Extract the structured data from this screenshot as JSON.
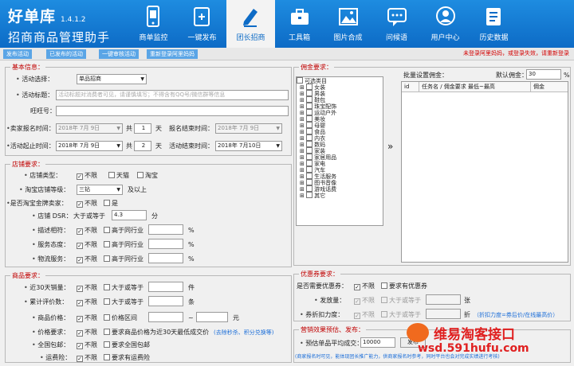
{
  "app": {
    "name": "好单库",
    "version": "1.4.1.2",
    "subtitle": "招商商品管理助手"
  },
  "nav": [
    {
      "label": "商单监控",
      "icon": "phone-monitor-icon"
    },
    {
      "label": "一键发布",
      "icon": "publish-icon"
    },
    {
      "label": "团长招商",
      "icon": "pen-icon"
    },
    {
      "label": "工具箱",
      "icon": "toolbox-icon"
    },
    {
      "label": "图片合成",
      "icon": "image-icon"
    },
    {
      "label": "问候语",
      "icon": "chat-icon"
    },
    {
      "label": "用户中心",
      "icon": "user-icon"
    },
    {
      "label": "历史数据",
      "icon": "history-icon"
    }
  ],
  "actions": {
    "publish": "发布活动",
    "published": "已发布的活动",
    "sync": "一键审核活动",
    "relogin": "重新登录阿里妈妈"
  },
  "warning": "未登录阿里妈妈，或登录失效，请重新登录",
  "basic": {
    "title": "基本信息：",
    "activity_select_label": "活动选择：",
    "activity_select_value": "单品招商",
    "activity_title_label": "活动标题：",
    "activity_title_placeholder": "活动标题对消费者可见，请谨慎填写；不得含有QQ号/微信群等信息",
    "wangwang_label": "旺旺号：",
    "sign_start_label": "卖家报名时间：",
    "sign_start_date": "2018年 7月 9日",
    "days_prefix": "共",
    "sign_days": "1",
    "days_suffix": "天",
    "sign_end_label": "报名结束时间：",
    "sign_end_date": "2018年 7月 9日",
    "act_start_label": "活动起止时间：",
    "act_start_date": "2018年 7月 9日",
    "act_days": "2",
    "act_end_label": "活动结束时间：",
    "act_end_date": "2018年 7月10日"
  },
  "shop": {
    "title": "店铺要求：",
    "type_label": "店铺类型：",
    "unlimited": "不限",
    "tmall": "天猫",
    "taobao": "淘宝",
    "level_label": "淘宝店铺等级：",
    "level_value": "三钻",
    "level_suffix": "及以上",
    "gold_label": "是否淘宝金牌卖家：",
    "yes": "是",
    "dsr_label": "店铺 DSR：",
    "dsr_prefix": "大于或等于",
    "dsr_value": "4.3",
    "dsr_unit": "分",
    "desc_label": "描述相符：",
    "above_industry": "高于同行业",
    "service_label": "服务态度：",
    "logistics_label": "物流服务：",
    "pct": "%"
  },
  "goods": {
    "title": "商品要求：",
    "sales_label": "近30天销量：",
    "gte": "大于或等于",
    "sales_unit": "件",
    "reviews_label": "累计评价数：",
    "reviews_unit": "条",
    "price_label": "商品价格：",
    "price_range": "价格区间",
    "tilde": "~",
    "yuan": "元",
    "price_req_label": "价格要求：",
    "price_req_opt": "要求商品价格为近30天最低成交价",
    "price_req_hint": "(去除秒杀、积分兑换等)",
    "freeship_label": "全国包邮：",
    "freeship_opt": "要求全国包邮",
    "insurance_label": "运费险：",
    "insurance_opt": "要求有运费险"
  },
  "commission": {
    "title": "佣金要求：",
    "root": "可选类目",
    "categories": [
      "女装",
      "男装",
      "鞋包",
      "珠宝配饰",
      "运动户外",
      "美妆",
      "母婴",
      "食品",
      "内衣",
      "数码",
      "家装",
      "家居用品",
      "家电",
      "汽车",
      "生活服务",
      "图书音像",
      "游戏话费",
      "其它"
    ],
    "arrow": "»",
    "batch_label": "批量设置佣金：",
    "default_label": "默认佣金：",
    "default_value": "30",
    "pct": "%",
    "col_id": "id",
    "col_name": "任务名 / 佣金要求 最低~最高",
    "col_commission": "佣金"
  },
  "coupon": {
    "title": "优惠券要求：",
    "need_label": "是否需要优惠券：",
    "unlimited": "不限",
    "need_opt": "要求有优惠券",
    "amount_label": "发放量：",
    "gte": "大于或等于",
    "amount_unit": "张",
    "discount_label": "券折扣力度：",
    "discount_unit": "折",
    "discount_hint": "（折扣力度=券后价/在线最高价）"
  },
  "marketing": {
    "title": "营销效果预估、发布：",
    "avg_label": "预估单品平均成交：",
    "avg_value": "10000",
    "publish_btn": "发布",
    "note": "(商家报名时可见，能体现团长推广能力，供商家报名时参考，同时平台也会对完成实绩进行考核)"
  },
  "watermark": {
    "line1": "维易淘客接口",
    "line2": "wsd.591hufu.com"
  }
}
